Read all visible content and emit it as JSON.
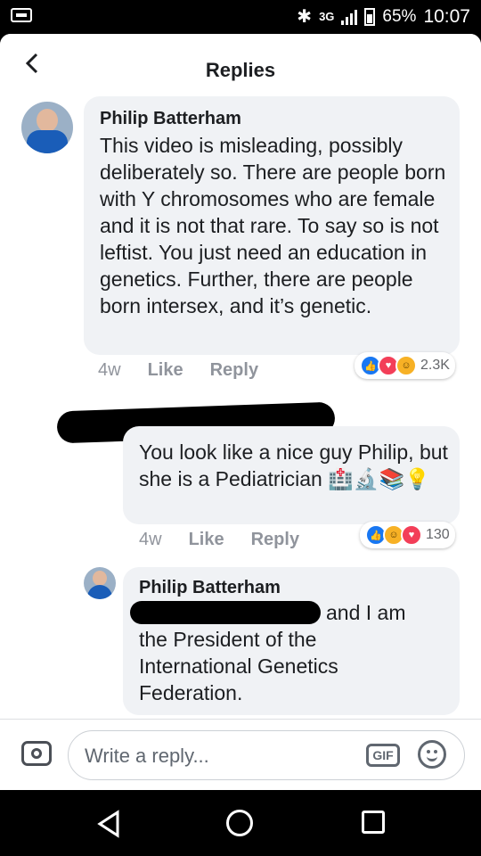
{
  "status_bar": {
    "network": "3G",
    "battery": "65%",
    "time": "10:07",
    "icons": [
      "notification-icon",
      "bluetooth-icon",
      "signal-icon",
      "battery-icon"
    ]
  },
  "header": {
    "title": "Replies",
    "back_icon": "back-arrow-icon"
  },
  "comments": [
    {
      "author": "Philip Batterham",
      "text": "This video is misleading, possibly deliberately so.  There are people born with Y chromosomes who are female and it is not that rare. To say so is not leftist.  You just need an education in genetics.  Further, there are people born intersex, and it’s genetic.",
      "time": "4w",
      "like_label": "Like",
      "reply_label": "Reply",
      "reaction_count": "2.3K"
    },
    {
      "author": "",
      "text": "You look like a nice guy Philip, but she is a Pediatrician",
      "emoji": "🏥🔬📚💡",
      "time": "4w",
      "like_label": "Like",
      "reply_label": "Reply",
      "reaction_count": "130"
    },
    {
      "author": "Philip Batterham",
      "text_after_redaction": "and I am",
      "text": "the President of the International Genetics Federation."
    }
  ],
  "composer": {
    "placeholder": "Write a reply...",
    "gif_label": "GIF",
    "icons": [
      "camera-icon",
      "gif-icon",
      "emoji-icon"
    ]
  },
  "nav_bar": {
    "icons": [
      "nav-back-icon",
      "nav-home-icon",
      "nav-recents-icon"
    ]
  }
}
